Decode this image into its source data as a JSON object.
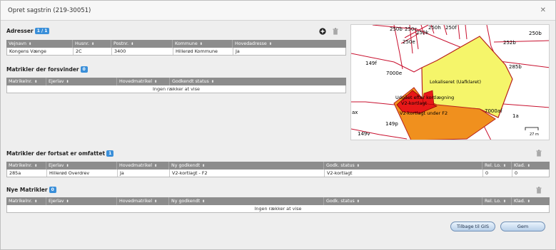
{
  "dialog": {
    "title": "Opret sagstrin (219-30051)",
    "close_icon": "close-icon"
  },
  "adresser": {
    "title": "Adresser",
    "badge": "1 / 1",
    "columns": [
      "Vejnavn",
      "Husnr.",
      "Postnr.",
      "Kommune",
      "Hovedadresse"
    ],
    "rows": [
      [
        "Kongens Vænge",
        "2C",
        "3400",
        "Hillerød Kommune",
        "Ja"
      ]
    ]
  },
  "forsvinder": {
    "title": "Matrikler der forsvinder",
    "badge": "0",
    "columns": [
      "Matrikelnr.",
      "Ejerlav",
      "Hovedmatrikel",
      "Godkendt status"
    ],
    "empty_text": "Ingen rækker at vise"
  },
  "omfattet": {
    "title": "Matrikler der fortsat er omfattet",
    "badge": "1",
    "columns": [
      "Matrikelnr.",
      "Ejerlav",
      "Hovedmatrikel",
      "Ny godkendt",
      "Godk. status",
      "Rel. Lo.",
      "Klad."
    ],
    "rows": [
      [
        "285a",
        "Hillerød Overdrev",
        "Ja",
        "V2-kortlagt - F2",
        "V2-kortlagt",
        "0",
        "0"
      ]
    ]
  },
  "nye": {
    "title": "Nye Matrikler",
    "badge": "0",
    "columns": [
      "Matrikelnr.",
      "Ejerlav",
      "Hovedmatrikel",
      "Ny godkendt",
      "Godk. status",
      "Rel. Lo.",
      "Klad."
    ],
    "empty_text": "Ingen rækker at vise"
  },
  "map": {
    "labels": {
      "l250b_tl": "250b",
      "l250c": "250c",
      "l250k": "250k",
      "l250h": "250h",
      "l250f": "250f",
      "l250e": "250e",
      "l250b_r": "250b",
      "l252b": "252b",
      "l149f": "149f",
      "l285b": "285b",
      "l7000e": "7000e",
      "l7000af": "7000af",
      "l1a": "1a",
      "lax": "ax",
      "l149p": "149p",
      "l149v": "149v"
    },
    "annotations": {
      "lokaliseret": "Lokaliseret (Uafklaret)",
      "udgaaet": "Udgået efter kortlægning",
      "v2kortlagt": "V2-kortlagt",
      "v2f2": "V2-kortlagt under F2"
    },
    "scale": "27 m",
    "colors": {
      "yellow": "#f5f56a",
      "orange": "#f0901e",
      "red": "#e81818",
      "lines": "#c8102e"
    }
  },
  "buttons": {
    "gis": "Tilbage til GIS",
    "save": "Gem"
  }
}
